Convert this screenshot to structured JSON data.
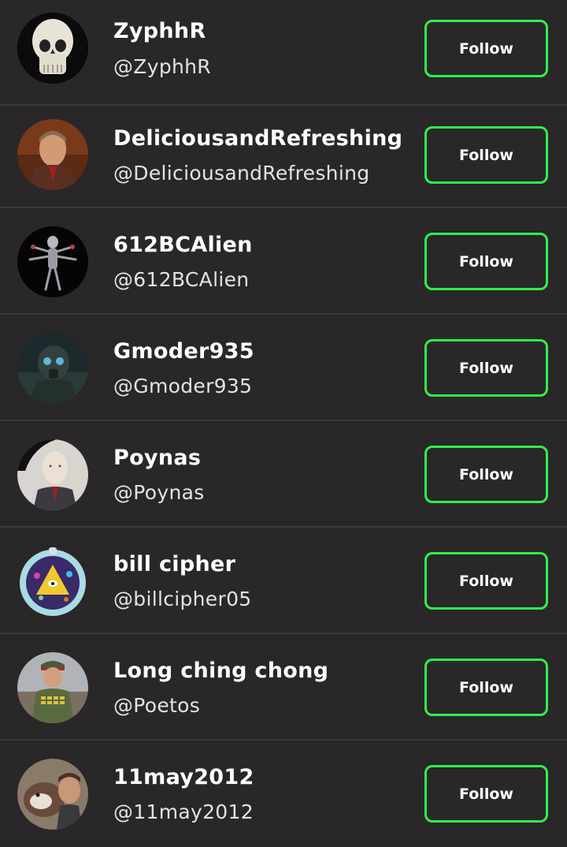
{
  "accent_color": "#2ff04a",
  "users": [
    {
      "name": "ZyphhR",
      "handle": "@ZyphhR",
      "follow_label": "Follow",
      "avatar": "skull-avatar"
    },
    {
      "name": "DeliciousandRefreshing",
      "handle": "@DeliciousandRefreshing",
      "follow_label": "Follow",
      "avatar": "man-portrait-avatar"
    },
    {
      "name": "612BCAlien",
      "handle": "@612BCAlien",
      "follow_label": "Follow",
      "avatar": "alien-figure-avatar"
    },
    {
      "name": "Gmoder935",
      "handle": "@Gmoder935",
      "follow_label": "Follow",
      "avatar": "gasmask-soldier-avatar"
    },
    {
      "name": "Poynas",
      "handle": "@Poynas",
      "follow_label": "Follow",
      "avatar": "bald-man-avatar"
    },
    {
      "name": "bill cipher",
      "handle": "@billcipher05",
      "follow_label": "Follow",
      "avatar": "bill-cipher-badge-avatar"
    },
    {
      "name": "Long ching chong",
      "handle": "@Poetos",
      "follow_label": "Follow",
      "avatar": "uniformed-leader-avatar"
    },
    {
      "name": "11may2012",
      "handle": "@11may2012",
      "follow_label": "Follow",
      "avatar": "dog-avatar"
    }
  ]
}
